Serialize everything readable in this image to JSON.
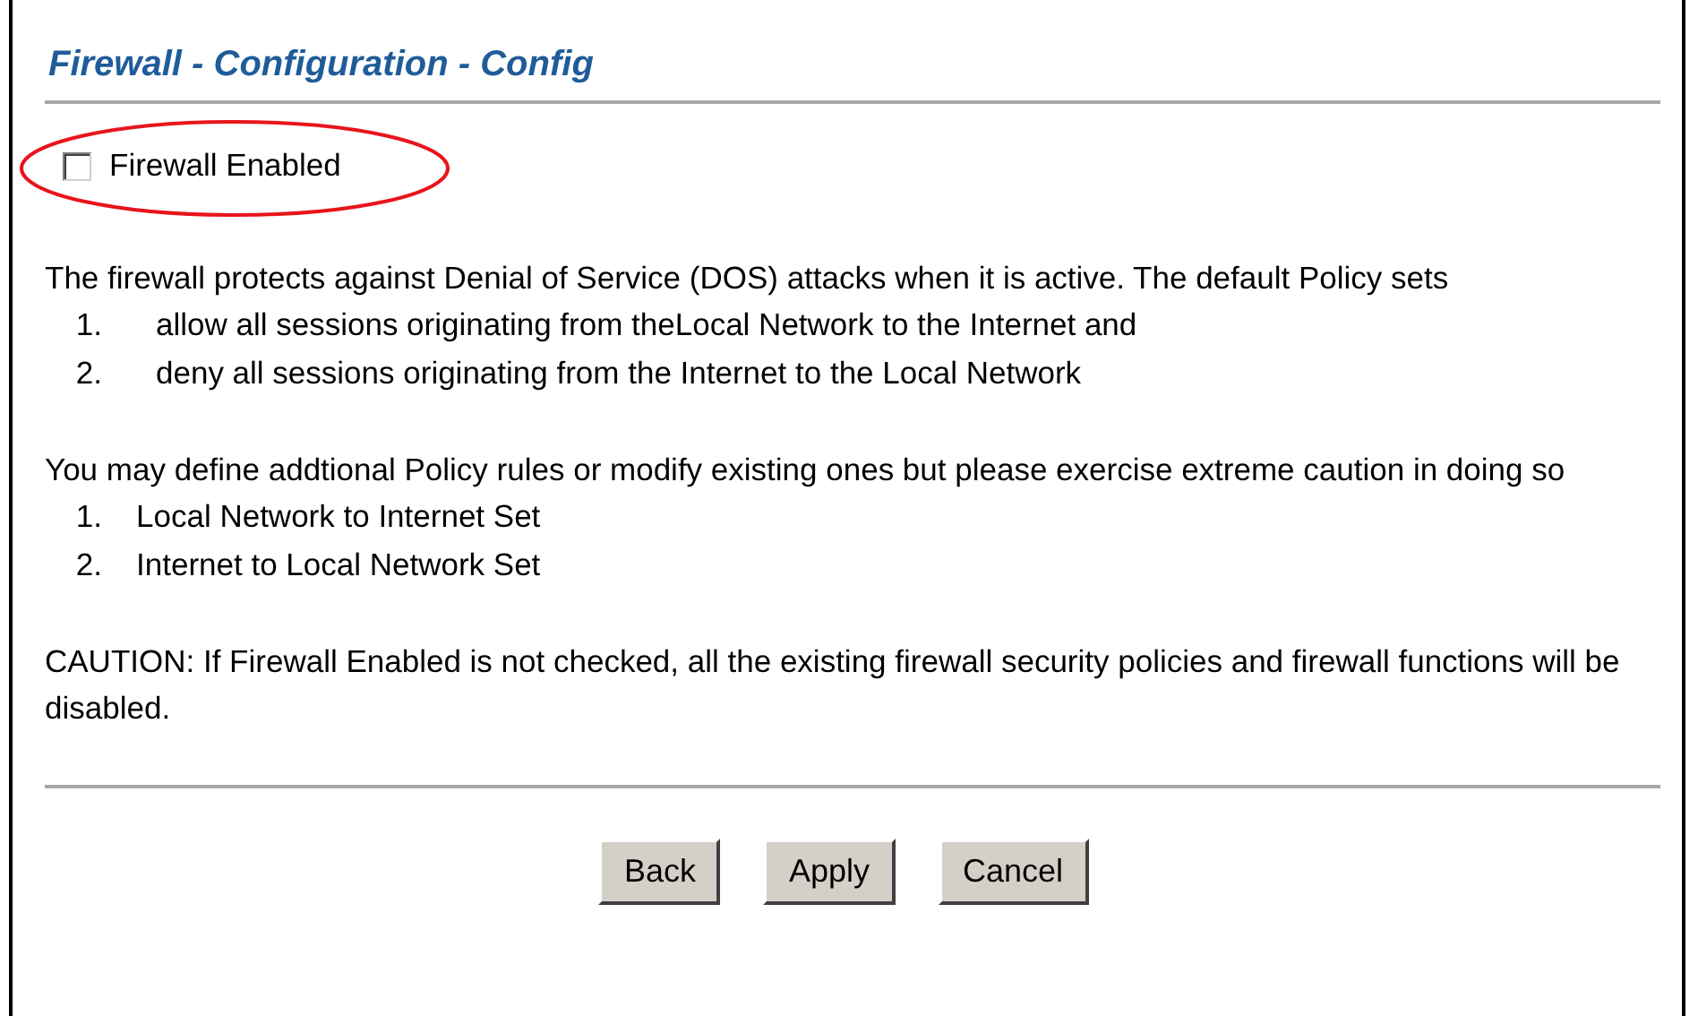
{
  "title": "Firewall - Configuration - Config",
  "firewall_enabled": {
    "label": "Firewall Enabled",
    "checked": false
  },
  "intro": "The firewall protects against Denial of Service (DOS) attacks when it is active. The default Policy sets",
  "intro_list": [
    {
      "number": "1.",
      "text": "allow all sessions originating from theLocal Network to the Internet and"
    },
    {
      "number": "2.",
      "text": "deny all sessions originating from the Internet to the Local Network"
    }
  ],
  "policy_text": "You may define addtional Policy rules or modify existing ones but please exercise extreme caution in doing so",
  "policy_list": [
    {
      "number": "1.",
      "text": "Local Network to Internet Set"
    },
    {
      "number": "2.",
      "text": "Internet to Local Network Set"
    }
  ],
  "caution": "CAUTION: If Firewall Enabled is not checked, all the existing firewall security policies and firewall functions will be disabled.",
  "buttons": [
    "Back",
    "Apply",
    "Cancel"
  ]
}
